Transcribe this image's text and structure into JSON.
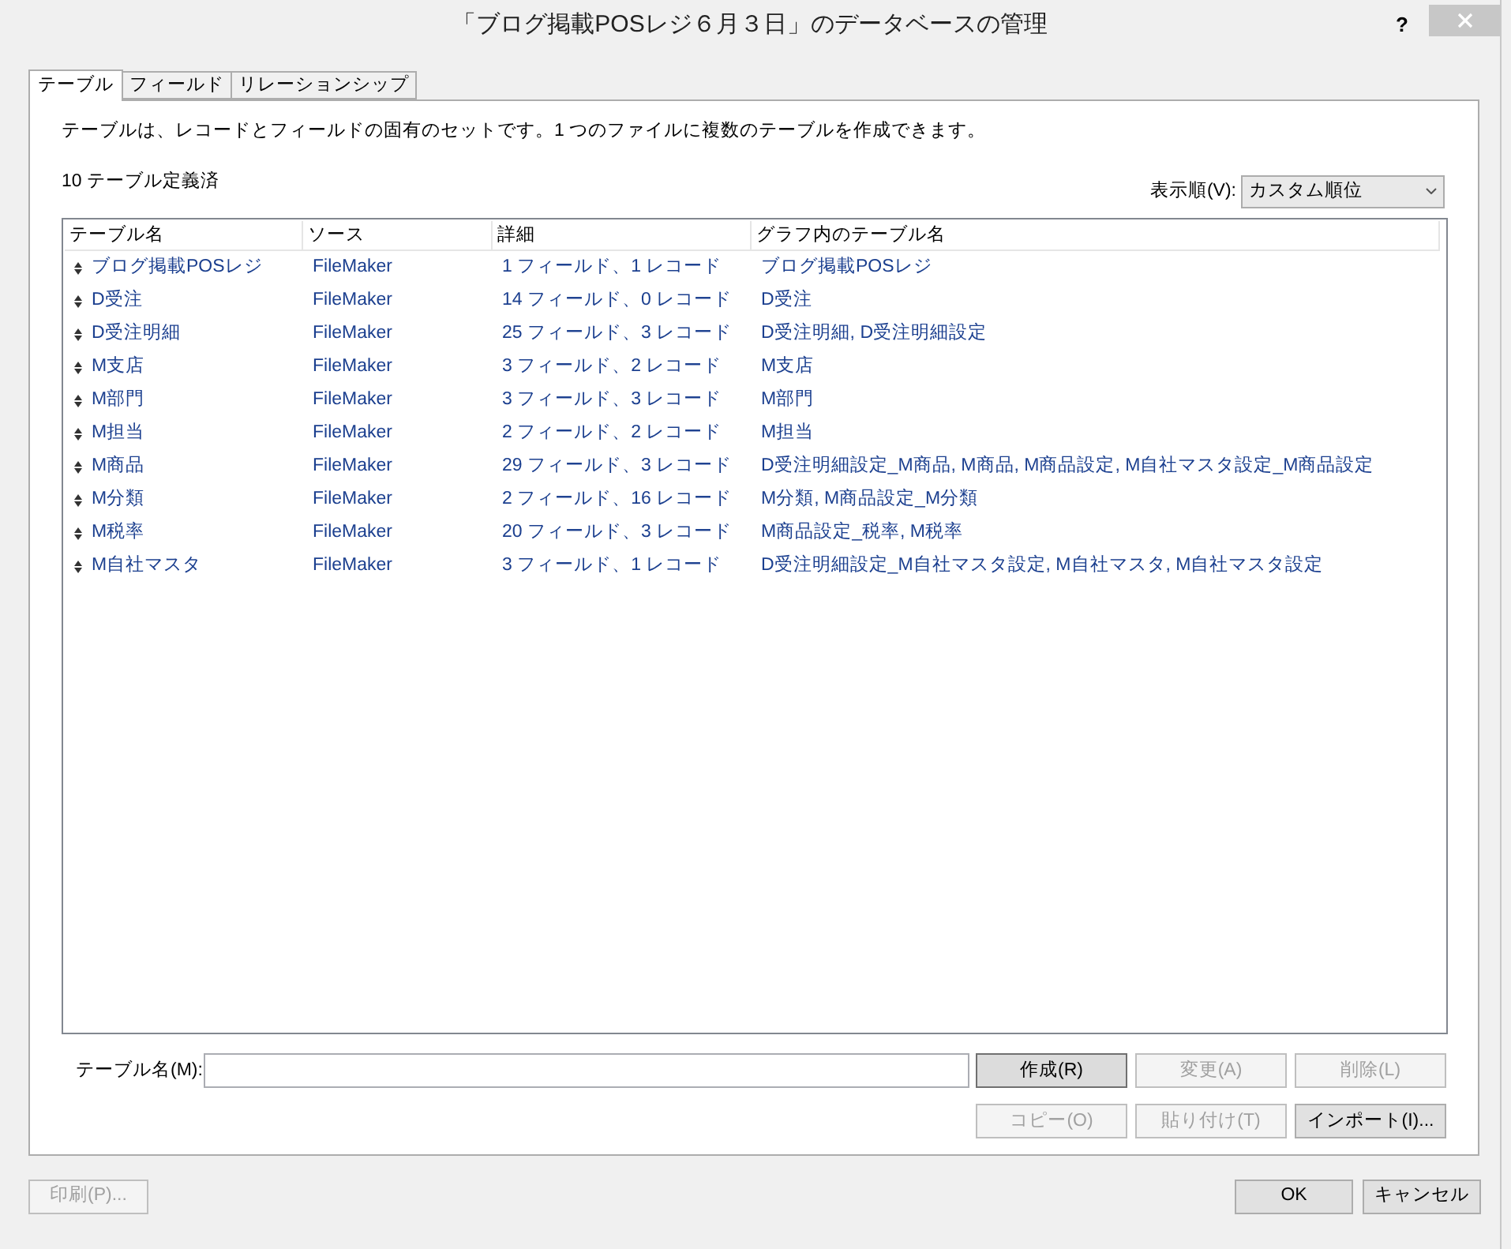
{
  "window": {
    "title": "「ブログ掲載POSレジ６月３日」のデータベースの管理",
    "help": "?"
  },
  "tabs": [
    {
      "label": "テーブル",
      "selected": true
    },
    {
      "label": "フィールド",
      "selected": false
    },
    {
      "label": "リレーションシップ",
      "selected": false
    }
  ],
  "description": "テーブルは、レコードとフィールドの固有のセットです。1 つのファイルに複数のテーブルを作成できます。",
  "count": "10 テーブル定義済",
  "sort": {
    "label": "表示順(V):",
    "value": "カスタム順位"
  },
  "table": {
    "columns": [
      "テーブル名",
      "ソース",
      "詳細",
      "グラフ内のテーブル名"
    ],
    "rows": [
      {
        "name": "ブログ掲載POSレジ",
        "source": "FileMaker",
        "details": "1 フィールド、1 レコード",
        "graph": "ブログ掲載POSレジ"
      },
      {
        "name": "D受注",
        "source": "FileMaker",
        "details": "14 フィールド、0 レコード",
        "graph": "D受注"
      },
      {
        "name": "D受注明細",
        "source": "FileMaker",
        "details": "25 フィールド、3 レコード",
        "graph": "D受注明細, D受注明細設定"
      },
      {
        "name": "M支店",
        "source": "FileMaker",
        "details": "3 フィールド、2 レコード",
        "graph": "M支店"
      },
      {
        "name": "M部門",
        "source": "FileMaker",
        "details": "3 フィールド、3 レコード",
        "graph": "M部門"
      },
      {
        "name": "M担当",
        "source": "FileMaker",
        "details": "2 フィールド、2 レコード",
        "graph": "M担当"
      },
      {
        "name": "M商品",
        "source": "FileMaker",
        "details": "29 フィールド、3 レコード",
        "graph": "D受注明細設定_M商品, M商品, M商品設定, M自社マスタ設定_M商品設定"
      },
      {
        "name": "M分類",
        "source": "FileMaker",
        "details": "2 フィールド、16 レコード",
        "graph": "M分類, M商品設定_M分類"
      },
      {
        "name": "M税率",
        "source": "FileMaker",
        "details": "20 フィールド、3 レコード",
        "graph": "M商品設定_税率, M税率"
      },
      {
        "name": "M自社マスタ",
        "source": "FileMaker",
        "details": "3 フィールド、1 レコード",
        "graph": "D受注明細設定_M自社マスタ設定, M自社マスタ, M自社マスタ設定"
      }
    ]
  },
  "name_field": {
    "label": "テーブル名(M):"
  },
  "buttons": [
    {
      "label": "作成(R)",
      "disabled": false,
      "default": true
    },
    {
      "label": "変更(A)",
      "disabled": true,
      "default": false
    },
    {
      "label": "削除(L)",
      "disabled": true,
      "default": false
    },
    {
      "label": "コピー(O)",
      "disabled": true,
      "default": false
    },
    {
      "label": "貼り付け(T)",
      "disabled": true,
      "default": false
    },
    {
      "label": "インポート(I)...",
      "disabled": false,
      "default": false
    }
  ],
  "footer_buttons": [
    {
      "label": "印刷(P)...",
      "disabled": true,
      "default": false
    },
    {
      "label": "OK",
      "disabled": false,
      "default": false
    },
    {
      "label": "キャンセル",
      "disabled": false,
      "default": false
    }
  ]
}
